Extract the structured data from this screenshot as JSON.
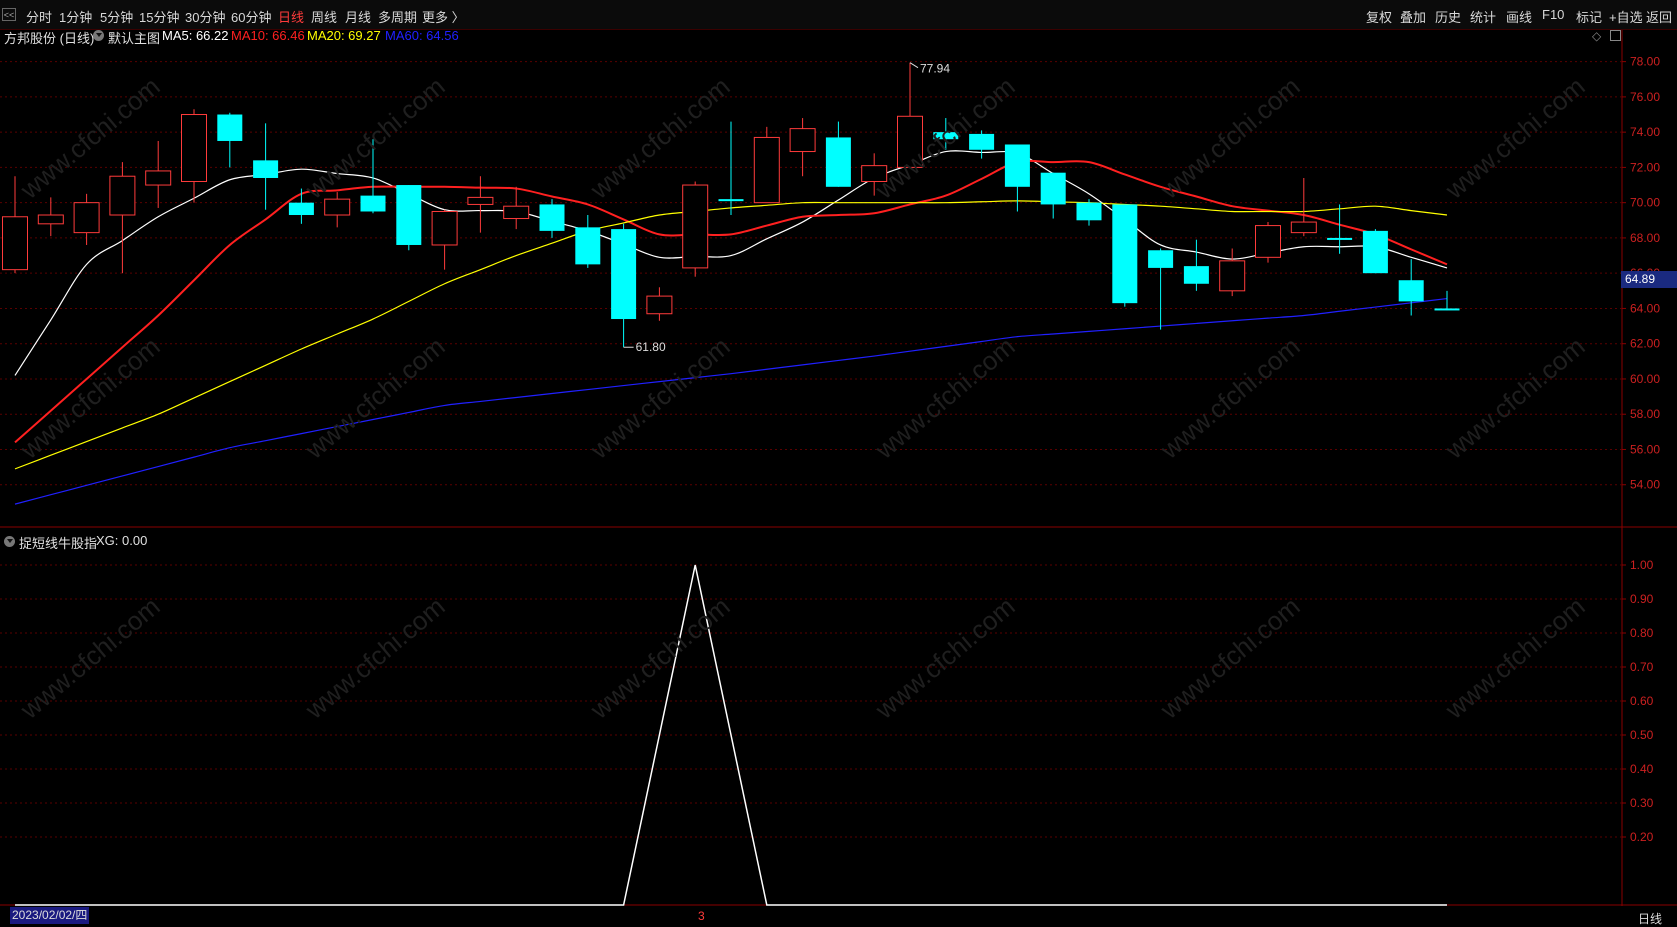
{
  "toolbar": {
    "collapse_icon": "left-collapse-icon",
    "periods": [
      "分时",
      "1分钟",
      "5分钟",
      "15分钟",
      "30分钟",
      "60分钟",
      "日线",
      "周线",
      "月线",
      "多周期",
      "更多 〉"
    ],
    "active_period": "日线",
    "right_buttons": [
      "复权",
      "叠加",
      "历史",
      "统计",
      "画线",
      "F10",
      "标记",
      "+自选",
      "返回"
    ]
  },
  "main_panel": {
    "stock": "方邦股份 (日线)",
    "chart_name": "默认主图",
    "ma_labels": [
      {
        "text": "MA5: 66.22",
        "color": "#ffffff"
      },
      {
        "text": "MA10: 66.46",
        "color": "#ff2020"
      },
      {
        "text": "MA20: 69.27",
        "color": "#ffff00"
      },
      {
        "text": "MA60: 64.56",
        "color": "#2020ff"
      }
    ],
    "current_price_tag": "64.89",
    "high_annotation": "77.94",
    "low_annotation": "61.80"
  },
  "sub_panel": {
    "name": "捉短线牛股指",
    "value_label": "XG: 0.00"
  },
  "bottom": {
    "date": "2023/02/02/四",
    "period": "日线",
    "marker": "3"
  },
  "chart_data": [
    {
      "type": "candlestick",
      "ylim": [
        52,
        79
      ],
      "yticks": [
        "54.00",
        "56.00",
        "58.00",
        "60.00",
        "62.00",
        "64.00",
        "66.00",
        "68.00",
        "70.00",
        "72.00",
        "74.00",
        "76.00",
        "78.00"
      ],
      "candles": [
        {
          "o": 66.2,
          "c": 69.2,
          "h": 71.5,
          "l": 66.0
        },
        {
          "o": 68.8,
          "c": 69.3,
          "h": 70.3,
          "l": 68.1
        },
        {
          "o": 68.3,
          "c": 70.0,
          "h": 70.5,
          "l": 67.6
        },
        {
          "o": 69.3,
          "c": 71.5,
          "h": 72.3,
          "l": 66.0
        },
        {
          "o": 71.0,
          "c": 71.8,
          "h": 73.5,
          "l": 69.7
        },
        {
          "o": 71.2,
          "c": 75.0,
          "h": 75.3,
          "l": 70.0
        },
        {
          "o": 75.0,
          "c": 73.5,
          "h": 75.1,
          "l": 72.0
        },
        {
          "o": 72.4,
          "c": 71.4,
          "h": 74.5,
          "l": 69.6
        },
        {
          "o": 70.0,
          "c": 69.3,
          "h": 70.8,
          "l": 68.8
        },
        {
          "o": 69.3,
          "c": 70.2,
          "h": 70.6,
          "l": 68.6
        },
        {
          "o": 70.4,
          "c": 69.5,
          "h": 73.6,
          "l": 69.4
        },
        {
          "o": 71.0,
          "c": 67.6,
          "h": 71.0,
          "l": 67.3
        },
        {
          "o": 67.6,
          "c": 69.5,
          "h": 69.6,
          "l": 66.2
        },
        {
          "o": 69.9,
          "c": 70.3,
          "h": 71.5,
          "l": 68.3
        },
        {
          "o": 69.1,
          "c": 69.8,
          "h": 70.9,
          "l": 68.5
        },
        {
          "o": 69.9,
          "c": 68.4,
          "h": 70.2,
          "l": 68.0
        },
        {
          "o": 68.6,
          "c": 66.5,
          "h": 69.3,
          "l": 66.3
        },
        {
          "o": 68.5,
          "c": 63.4,
          "h": 68.8,
          "l": 61.8
        },
        {
          "o": 63.7,
          "c": 64.7,
          "h": 65.2,
          "l": 63.3
        },
        {
          "o": 66.3,
          "c": 71.0,
          "h": 71.2,
          "l": 65.8
        },
        {
          "o": 70.2,
          "c": 70.1,
          "h": 74.6,
          "l": 69.3
        },
        {
          "o": 70.0,
          "c": 73.7,
          "h": 74.3,
          "l": 70.0
        },
        {
          "o": 72.9,
          "c": 74.2,
          "h": 74.8,
          "l": 71.5
        },
        {
          "o": 73.7,
          "c": 70.9,
          "h": 74.6,
          "l": 70.9
        },
        {
          "o": 71.2,
          "c": 72.1,
          "h": 72.8,
          "l": 70.4
        },
        {
          "o": 72.0,
          "c": 74.9,
          "h": 77.94,
          "l": 72.0
        },
        {
          "o": 74.0,
          "c": 73.6,
          "h": 74.8,
          "l": 73.0
        },
        {
          "o": 73.9,
          "c": 73.0,
          "h": 74.1,
          "l": 72.5
        },
        {
          "o": 73.3,
          "c": 70.9,
          "h": 73.3,
          "l": 69.5
        },
        {
          "o": 71.7,
          "c": 69.9,
          "h": 71.7,
          "l": 69.1
        },
        {
          "o": 70.0,
          "c": 69.0,
          "h": 70.2,
          "l": 68.7
        },
        {
          "o": 69.9,
          "c": 64.3,
          "h": 69.9,
          "l": 64.1
        },
        {
          "o": 67.3,
          "c": 66.3,
          "h": 67.4,
          "l": 62.8
        },
        {
          "o": 66.4,
          "c": 65.4,
          "h": 67.9,
          "l": 65.0
        },
        {
          "o": 65.0,
          "c": 66.7,
          "h": 67.4,
          "l": 64.7
        },
        {
          "o": 66.9,
          "c": 68.7,
          "h": 68.9,
          "l": 66.6
        },
        {
          "o": 68.3,
          "c": 68.9,
          "h": 71.4,
          "l": 68.1
        },
        {
          "o": 68.0,
          "c": 67.9,
          "h": 69.9,
          "l": 67.1
        },
        {
          "o": 68.4,
          "c": 66.0,
          "h": 68.5,
          "l": 66.0
        },
        {
          "o": 65.6,
          "c": 64.4,
          "h": 66.8,
          "l": 63.6
        },
        {
          "o": 64.0,
          "c": 63.9,
          "h": 65.0,
          "l": 63.9
        }
      ],
      "series": [
        {
          "name": "MA5",
          "color": "#ffffff",
          "values": [
            60.2,
            null,
            66.5,
            null,
            69.2,
            null,
            71.3,
            null,
            71.9,
            null,
            71.4,
            null,
            69.6,
            null,
            69.5,
            null,
            68.4,
            null,
            66.9,
            null,
            67.0,
            null,
            68.9,
            null,
            71.4,
            null,
            72.9,
            null,
            72.8,
            null,
            70.5,
            null,
            67.6,
            null,
            66.8,
            null,
            67.5,
            null,
            67.5,
            null,
            66.3
          ]
        },
        {
          "name": "MA10",
          "color": "#ff2020",
          "values": [
            56.4,
            null,
            null,
            null,
            63.6,
            null,
            67.6,
            null,
            70.5,
            null,
            70.9,
            null,
            70.9,
            null,
            70.8,
            null,
            69.9,
            null,
            68.2,
            null,
            68.2,
            null,
            69.2,
            null,
            69.4,
            null,
            70.4,
            null,
            72.3,
            null,
            72.3,
            null,
            70.9,
            null,
            69.8,
            null,
            69.3,
            null,
            68.2,
            null,
            66.5
          ]
        },
        {
          "name": "MA20",
          "color": "#ffff00",
          "values": [
            54.9,
            null,
            null,
            null,
            58.0,
            null,
            null,
            null,
            61.7,
            null,
            63.4,
            null,
            65.4,
            null,
            67.0,
            null,
            68.4,
            null,
            69.3,
            null,
            69.7,
            null,
            70.0,
            null,
            70.0,
            null,
            70.0,
            null,
            70.1,
            null,
            70.0,
            null,
            69.8,
            null,
            69.5,
            null,
            69.5,
            null,
            69.8,
            null,
            69.3
          ]
        },
        {
          "name": "MA60",
          "color": "#2020ff",
          "values": [
            52.9,
            null,
            null,
            null,
            null,
            null,
            56.1,
            null,
            null,
            null,
            null,
            null,
            58.5,
            null,
            null,
            null,
            59.4,
            null,
            null,
            null,
            60.3,
            null,
            null,
            null,
            61.3,
            null,
            null,
            null,
            62.4,
            null,
            null,
            null,
            63.0,
            null,
            null,
            null,
            63.6,
            null,
            null,
            null,
            64.56
          ]
        }
      ]
    },
    {
      "type": "line",
      "ylim": [
        0,
        1.05
      ],
      "yticks": [
        "0.20",
        "0.30",
        "0.40",
        "0.50",
        "0.60",
        "0.70",
        "0.80",
        "0.90",
        "1.00"
      ],
      "series": [
        {
          "name": "XG",
          "color": "#ffffff",
          "values": [
            0,
            null,
            null,
            null,
            null,
            null,
            null,
            null,
            null,
            null,
            null,
            null,
            null,
            null,
            null,
            null,
            null,
            0,
            null,
            1,
            null,
            0,
            null,
            null,
            null,
            null,
            null,
            null,
            null,
            null,
            null,
            null,
            null,
            null,
            null,
            null,
            null,
            null,
            null,
            null,
            0
          ]
        }
      ]
    }
  ]
}
